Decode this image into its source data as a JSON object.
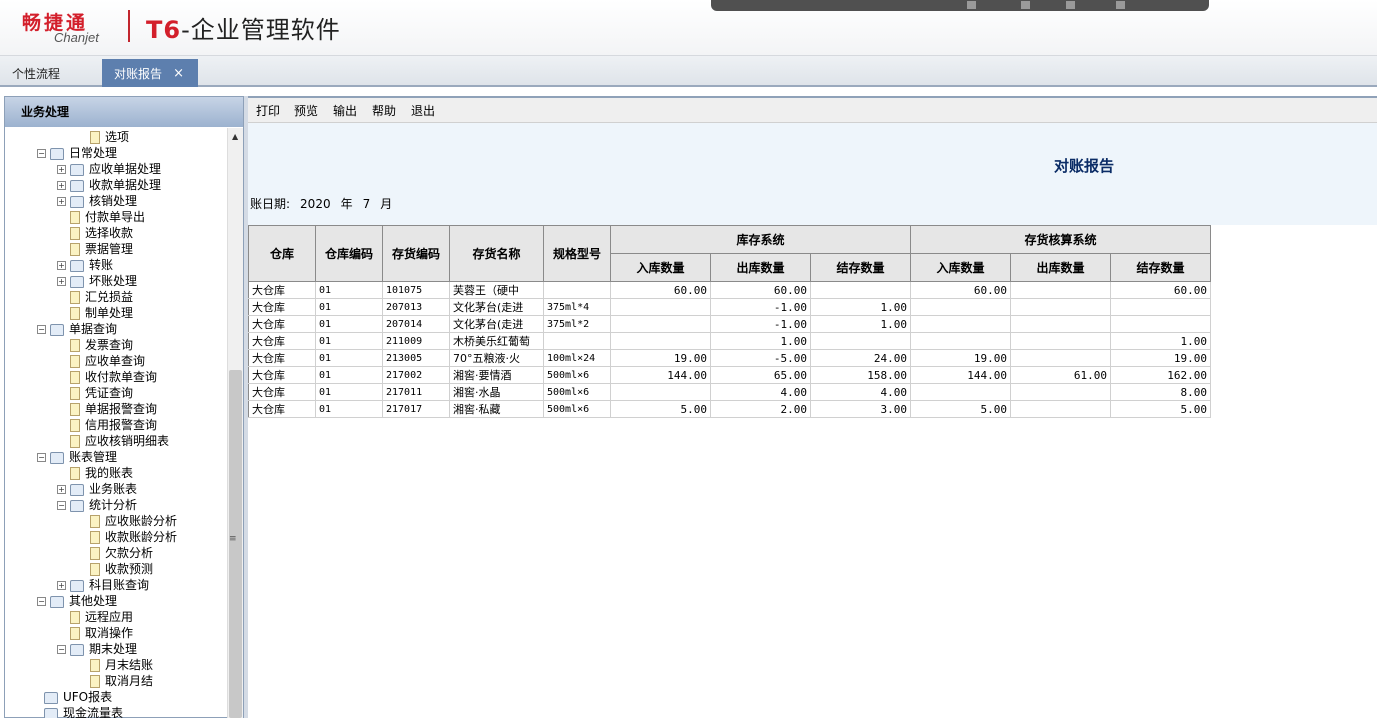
{
  "header": {
    "brand_cn": "畅捷通",
    "brand_en": "Chanjet",
    "product_t6": "T6",
    "product_name": "-企业管理软件"
  },
  "tabs": [
    {
      "label": "个性流程"
    },
    {
      "label": "对账报告",
      "close": "×"
    }
  ],
  "sidebar": {
    "title": "业务处理",
    "items": [
      {
        "label": "选项",
        "type": "doc",
        "level": 3
      },
      {
        "label": "日常处理",
        "type": "folder",
        "level": 1,
        "exp": "−"
      },
      {
        "label": "应收单据处理",
        "type": "folder",
        "level": 2,
        "exp": "+"
      },
      {
        "label": "收款单据处理",
        "type": "folder",
        "level": 2,
        "exp": "+"
      },
      {
        "label": "核销处理",
        "type": "folder",
        "level": 2,
        "exp": "+"
      },
      {
        "label": "付款单导出",
        "type": "doc",
        "level": 2
      },
      {
        "label": "选择收款",
        "type": "doc",
        "level": 2
      },
      {
        "label": "票据管理",
        "type": "doc",
        "level": 2
      },
      {
        "label": "转账",
        "type": "folder",
        "level": 2,
        "exp": "+"
      },
      {
        "label": "坏账处理",
        "type": "folder",
        "level": 2,
        "exp": "+"
      },
      {
        "label": "汇兑损益",
        "type": "doc",
        "level": 2
      },
      {
        "label": "制单处理",
        "type": "doc",
        "level": 2
      },
      {
        "label": "单据查询",
        "type": "folder",
        "level": 1,
        "exp": "−"
      },
      {
        "label": "发票查询",
        "type": "doc",
        "level": 2
      },
      {
        "label": "应收单查询",
        "type": "doc",
        "level": 2
      },
      {
        "label": "收付款单查询",
        "type": "doc",
        "level": 2
      },
      {
        "label": "凭证查询",
        "type": "doc",
        "level": 2
      },
      {
        "label": "单据报警查询",
        "type": "doc",
        "level": 2
      },
      {
        "label": "信用报警查询",
        "type": "doc",
        "level": 2
      },
      {
        "label": "应收核销明细表",
        "type": "doc",
        "level": 2
      },
      {
        "label": "账表管理",
        "type": "folder",
        "level": 1,
        "exp": "−"
      },
      {
        "label": "我的账表",
        "type": "doc",
        "level": 2
      },
      {
        "label": "业务账表",
        "type": "folder",
        "level": 2,
        "exp": "+"
      },
      {
        "label": "统计分析",
        "type": "folder",
        "level": 2,
        "exp": "−"
      },
      {
        "label": "应收账龄分析",
        "type": "doc",
        "level": 3
      },
      {
        "label": "收款账龄分析",
        "type": "doc",
        "level": 3
      },
      {
        "label": "欠款分析",
        "type": "doc",
        "level": 3
      },
      {
        "label": "收款预测",
        "type": "doc",
        "level": 3
      },
      {
        "label": "科目账查询",
        "type": "folder",
        "level": 2,
        "exp": "+"
      },
      {
        "label": "其他处理",
        "type": "folder",
        "level": 1,
        "exp": "−"
      },
      {
        "label": "远程应用",
        "type": "doc",
        "level": 2
      },
      {
        "label": "取消操作",
        "type": "doc",
        "level": 2
      },
      {
        "label": "期末处理",
        "type": "folder",
        "level": 2,
        "exp": "−"
      },
      {
        "label": "月末结账",
        "type": "doc",
        "level": 3
      },
      {
        "label": "取消月结",
        "type": "doc",
        "level": 3
      },
      {
        "label": "UFO报表",
        "type": "folder",
        "level": 0
      },
      {
        "label": "现金流量表",
        "type": "folder",
        "level": 0
      }
    ]
  },
  "toolbar": {
    "print": "打印",
    "preview": "预览",
    "export": "输出",
    "help": "帮助",
    "exit": "退出"
  },
  "report": {
    "title": "对账报告",
    "date_label": "账日期:",
    "year": "2020",
    "year_unit": "年",
    "month": "7",
    "month_unit": "月"
  },
  "table": {
    "headers": {
      "warehouse": "仓库",
      "warehouse_code": "仓库编码",
      "item_code": "存货编码",
      "item_name": "存货名称",
      "spec": "规格型号",
      "group_inventory": "库存系统",
      "group_accounting": "存货核算系统",
      "in_qty": "入库数量",
      "out_qty": "出库数量",
      "balance_qty": "结存数量"
    },
    "rows": [
      {
        "warehouse": "大仓库",
        "wh_code": "01",
        "code": "101075",
        "name": "芙蓉王（硬中",
        "spec": "",
        "inv_in": "60.00",
        "inv_out": "60.00",
        "inv_bal": "",
        "acc_in": "60.00",
        "acc_out": "",
        "acc_bal": "60.00"
      },
      {
        "warehouse": "大仓库",
        "wh_code": "01",
        "code": "207013",
        "name": "文化茅台(走进",
        "spec": "375ml*4",
        "inv_in": "",
        "inv_out": "-1.00",
        "inv_bal": "1.00",
        "acc_in": "",
        "acc_out": "",
        "acc_bal": ""
      },
      {
        "warehouse": "大仓库",
        "wh_code": "01",
        "code": "207014",
        "name": "文化茅台(走进",
        "spec": "375ml*2",
        "inv_in": "",
        "inv_out": "-1.00",
        "inv_bal": "1.00",
        "acc_in": "",
        "acc_out": "",
        "acc_bal": ""
      },
      {
        "warehouse": "大仓库",
        "wh_code": "01",
        "code": "211009",
        "name": "木桥美乐红葡萄",
        "spec": "",
        "inv_in": "",
        "inv_out": "1.00",
        "inv_bal": "",
        "acc_in": "",
        "acc_out": "",
        "acc_bal": "1.00"
      },
      {
        "warehouse": "大仓库",
        "wh_code": "01",
        "code": "213005",
        "name": "70°五粮液·火",
        "spec": "100ml×24",
        "inv_in": "19.00",
        "inv_out": "-5.00",
        "inv_bal": "24.00",
        "acc_in": "19.00",
        "acc_out": "",
        "acc_bal": "19.00"
      },
      {
        "warehouse": "大仓库",
        "wh_code": "01",
        "code": "217002",
        "name": "湘窖·要情酒",
        "spec": "500ml×6",
        "inv_in": "144.00",
        "inv_out": "65.00",
        "inv_bal": "158.00",
        "acc_in": "144.00",
        "acc_out": "61.00",
        "acc_bal": "162.00"
      },
      {
        "warehouse": "大仓库",
        "wh_code": "01",
        "code": "217011",
        "name": "湘窖·水晶",
        "spec": "500ml×6",
        "inv_in": "",
        "inv_out": "4.00",
        "inv_bal": "4.00",
        "acc_in": "",
        "acc_out": "",
        "acc_bal": "8.00"
      },
      {
        "warehouse": "大仓库",
        "wh_code": "01",
        "code": "217017",
        "name": "湘窖·私藏",
        "spec": "500ml×6",
        "inv_in": "5.00",
        "inv_out": "2.00",
        "inv_bal": "3.00",
        "acc_in": "5.00",
        "acc_out": "",
        "acc_bal": "5.00"
      }
    ]
  }
}
